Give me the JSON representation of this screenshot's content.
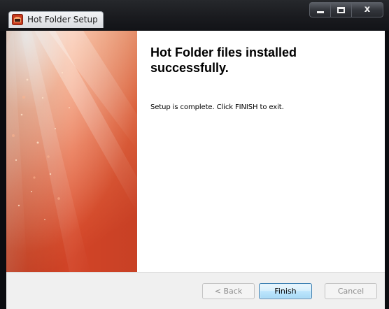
{
  "window": {
    "title": "Hot Folder Setup",
    "icon": "hot-folder-app-icon",
    "caption_buttons": {
      "minimize": "minimize-icon",
      "maximize": "maximize-icon",
      "close_label": "x"
    }
  },
  "content": {
    "heading": "Hot Folder files installed successfully.",
    "message": "Setup is complete. Click FINISH to exit."
  },
  "buttons": {
    "back": "< Back",
    "finish": "Finish",
    "cancel": "Cancel"
  },
  "colors": {
    "banner_top": "#f7c7ad",
    "banner_mid": "#ef7a52",
    "banner_bottom": "#d94a2c",
    "finish_border": "#3c7fb1",
    "window_frame": "#0b0c10"
  }
}
